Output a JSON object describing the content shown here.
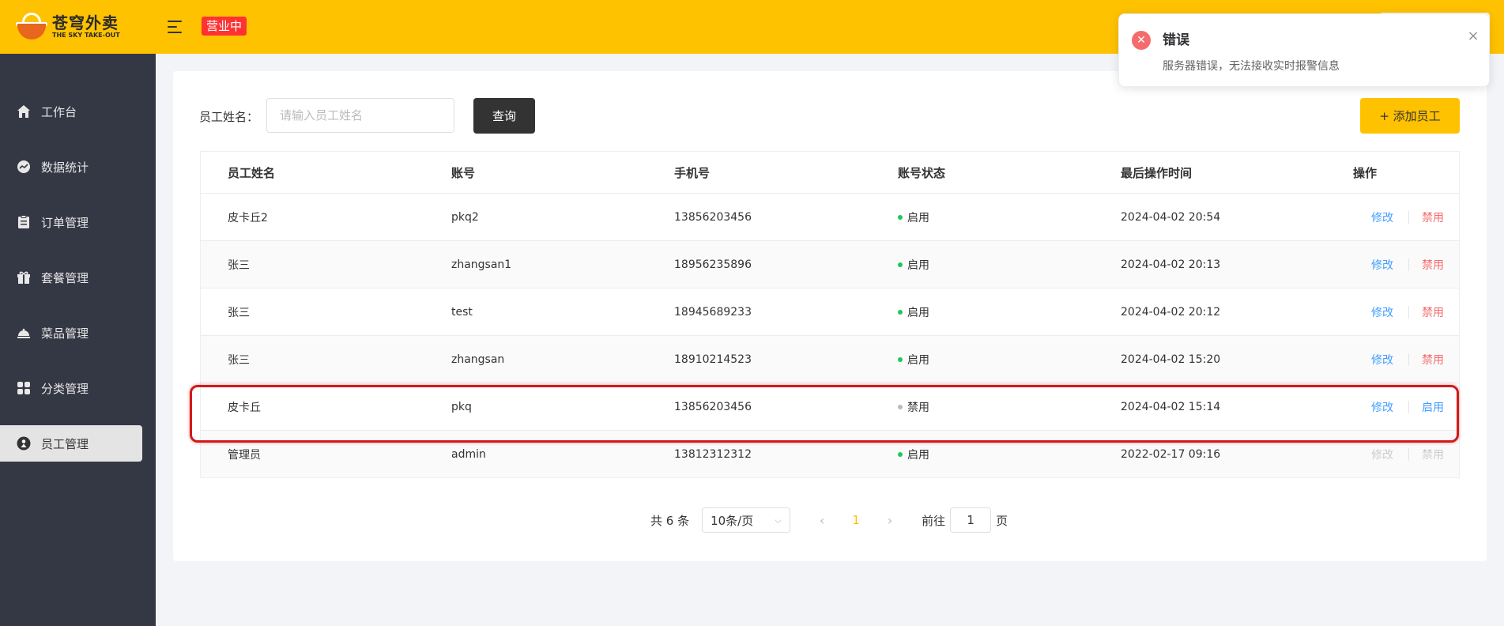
{
  "header": {
    "logo_cn": "苍穹外卖",
    "logo_en": "THE SKY TAKE-OUT",
    "status_tag": "营业中"
  },
  "sidebar": {
    "items": [
      {
        "label": "工作台",
        "icon": "home-icon"
      },
      {
        "label": "数据统计",
        "icon": "chart-icon"
      },
      {
        "label": "订单管理",
        "icon": "clipboard-icon"
      },
      {
        "label": "套餐管理",
        "icon": "gift-icon"
      },
      {
        "label": "菜品管理",
        "icon": "dish-icon"
      },
      {
        "label": "分类管理",
        "icon": "grid-icon"
      },
      {
        "label": "员工管理",
        "icon": "user-icon"
      }
    ],
    "active_index": 6
  },
  "search": {
    "label": "员工姓名：",
    "placeholder": "请输入员工姓名",
    "value": "",
    "query_button": "查询"
  },
  "add_button": "+ 添加员工",
  "table": {
    "headers": [
      "员工姓名",
      "账号",
      "手机号",
      "账号状态",
      "最后操作时间",
      "操作"
    ],
    "rows": [
      {
        "name": "皮卡丘2",
        "account": "pkq2",
        "phone": "13856203456",
        "status": "启用",
        "updated": "2024-04-02 20:54",
        "edit": "修改",
        "toggle": "禁用"
      },
      {
        "name": "张三",
        "account": "zhangsan1",
        "phone": "18956235896",
        "status": "启用",
        "updated": "2024-04-02 20:13",
        "edit": "修改",
        "toggle": "禁用"
      },
      {
        "name": "张三",
        "account": "test",
        "phone": "18945689233",
        "status": "启用",
        "updated": "2024-04-02 20:12",
        "edit": "修改",
        "toggle": "禁用"
      },
      {
        "name": "张三",
        "account": "zhangsan",
        "phone": "18910214523",
        "status": "启用",
        "updated": "2024-04-02 15:20",
        "edit": "修改",
        "toggle": "禁用"
      },
      {
        "name": "皮卡丘",
        "account": "pkq",
        "phone": "13856203456",
        "status": "禁用",
        "updated": "2024-04-02 15:14",
        "edit": "修改",
        "toggle": "启用"
      },
      {
        "name": "管理员",
        "account": "admin",
        "phone": "13812312312",
        "status": "启用",
        "updated": "2022-02-17 09:16",
        "edit": "修改",
        "toggle": "禁用"
      }
    ]
  },
  "pagination": {
    "total": "共 6 条",
    "page_size": "10条/页",
    "current_page": "1",
    "goto_label": "前往",
    "goto_value": "1",
    "goto_suffix": "页"
  },
  "notification": {
    "title": "错误",
    "message": "服务器错误，无法接收实时报警信息"
  },
  "colors": {
    "brand": "#ffc200",
    "sidebar": "#343744",
    "enabled_dot": "#22c55e",
    "disabled_dot": "#bbbbbb",
    "link_blue": "#419eff",
    "danger_red": "#f56c6c",
    "highlight": "#d11a1a"
  }
}
